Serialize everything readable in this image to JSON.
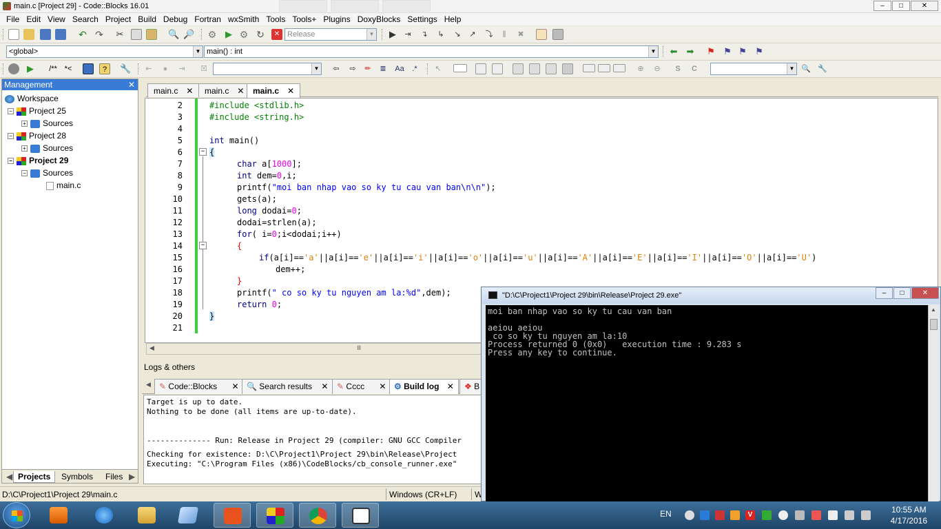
{
  "window": {
    "title": "main.c [Project 29] - Code::Blocks 16.01",
    "controls": [
      "–",
      "□",
      "✕"
    ]
  },
  "menu": [
    "File",
    "Edit",
    "View",
    "Search",
    "Project",
    "Build",
    "Debug",
    "Fortran",
    "wxSmith",
    "Tools",
    "Tools+",
    "Plugins",
    "DoxyBlocks",
    "Settings",
    "Help"
  ],
  "toolbar": {
    "build_target": "Release",
    "scope": "<global>",
    "function": "main() : int",
    "doc_comment": "/**",
    "doc_inline": "*<"
  },
  "management": {
    "title": "Management",
    "close": "✕",
    "tree": {
      "root": "Workspace",
      "projects": [
        {
          "name": "Project 25",
          "folder": "Sources"
        },
        {
          "name": "Project 28",
          "folder": "Sources"
        },
        {
          "name": "Project 29",
          "folder": "Sources",
          "file": "main.c"
        }
      ]
    },
    "tabs": [
      "Projects",
      "Symbols",
      "Files"
    ]
  },
  "editor": {
    "tabs": [
      {
        "label": "main.c",
        "close": "✕"
      },
      {
        "label": "main.c",
        "close": "✕"
      },
      {
        "label": "main.c",
        "close": "✕"
      }
    ],
    "line_numbers": [
      "2",
      "3",
      "4",
      "5",
      "6",
      "7",
      "8",
      "9",
      "10",
      "11",
      "12",
      "13",
      "14",
      "15",
      "16",
      "17",
      "18",
      "19",
      "20",
      "21"
    ],
    "code": {
      "l2": "#include <stdlib.h>",
      "l3": "#include <string.h>",
      "l5_kw": "int",
      "l5_rest": " main()",
      "l6": "{",
      "l7_kw": "char",
      "l7_a": " a[",
      "l7_n": "1000",
      "l7_b": "];",
      "l8_kw": "int",
      "l8_a": " dem=",
      "l8_n": "0",
      "l8_b": ",i;",
      "l9_a": "printf(",
      "l9_s": "\"moi ban nhap vao so ky tu cau van ban\\n\\n\"",
      "l9_b": ");",
      "l10": "gets(a);",
      "l11_kw": "long",
      "l11_a": " dodai=",
      "l11_n": "0",
      "l11_b": ";",
      "l12": "dodai=strlen(a);",
      "l13_kw": "for",
      "l13_a": "( i=",
      "l13_n": "0",
      "l13_b": ";i<dodai;i++)",
      "l14": "{",
      "l15_kw": "if",
      "l15_p0": "(a[i]==",
      "l15_c1": "'a'",
      "l15_p1": "||a[i]==",
      "l15_c2": "'e'",
      "l15_p2": "||a[i]==",
      "l15_c3": "'i'",
      "l15_p3": "||a[i]==",
      "l15_c4": "'o'",
      "l15_p4": "||a[i]==",
      "l15_c5": "'u'",
      "l15_p5": "||a[i]==",
      "l15_c6": "'A'",
      "l15_p6": "||a[i]==",
      "l15_c7": "'E'",
      "l15_p7": "||a[i]==",
      "l15_c8": "'I'",
      "l15_p8": "||a[i]==",
      "l15_c9": "'O'",
      "l15_p9": "||a[i]==",
      "l15_c10": "'U'",
      "l15_end": ")",
      "l16": "dem++;",
      "l17": "}",
      "l18_a": "printf(",
      "l18_s": "\" co so ky tu nguyen am la:%d\"",
      "l18_b": ",dem);",
      "l19_kw": "return",
      "l19_sp": " ",
      "l19_n": "0",
      "l19_b": ";",
      "l20": "}"
    },
    "hscroll_grip": "Ⅲ"
  },
  "logs": {
    "title": "Logs & others",
    "tabs": [
      "Code::Blocks",
      "Search results",
      "Cccc",
      "Build log",
      "B"
    ],
    "lines": [
      "Target is up to date.",
      "Nothing to be done (all items are up-to-date).",
      "",
      "",
      "-------------- Run: Release in Project 29 (compiler: GNU GCC Compiler",
      "Checking for existence: D:\\C\\Project1\\Project 29\\bin\\Release\\Project",
      "Executing: \"C:\\Program Files (x86)\\CodeBlocks/cb_console_runner.exe\""
    ]
  },
  "statusbar": {
    "path": "D:\\C\\Project1\\Project 29\\main.c",
    "eol": "Windows (CR+LF)",
    "enc": "W"
  },
  "console": {
    "title": "\"D:\\C\\Project1\\Project 29\\bin\\Release\\Project 29.exe\"",
    "lines": [
      "moi ban nhap vao so ky tu cau van ban",
      "",
      "aeiou aeiou",
      " co so ky tu nguyen am la:10",
      "Process returned 0 (0x0)   execution time : 9.283 s",
      "Press any key to continue."
    ]
  },
  "taskbar": {
    "lang": "EN",
    "time": "10:55 AM",
    "date": "4/17/2016"
  }
}
